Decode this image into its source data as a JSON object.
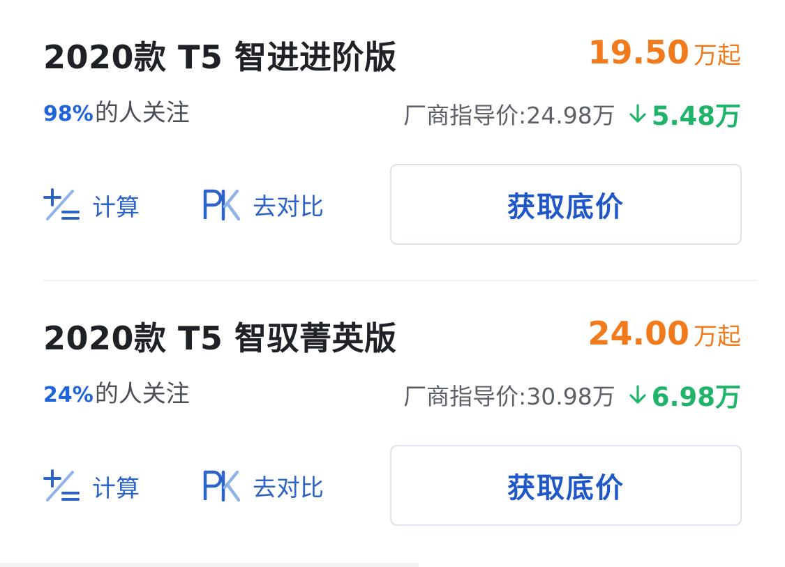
{
  "trims": [
    {
      "title": "2020款 T5 智进进阶版",
      "price": "19.50",
      "price_unit": "万起",
      "attention_percent": "98%",
      "attention_text": "的人关注",
      "guide_label": "厂商指导价:24.98万",
      "price_drop": "5.48万",
      "calc_label": "计算",
      "pk_label": "去对比",
      "cta_label": "获取底价"
    },
    {
      "title": "2020款 T5 智驭菁英版",
      "price": "24.00",
      "price_unit": "万起",
      "attention_percent": "24%",
      "attention_text": "的人关注",
      "guide_label": "厂商指导价:30.98万",
      "price_drop": "6.98万",
      "calc_label": "计算",
      "pk_label": "去对比",
      "cta_label": "获取底价"
    }
  ],
  "icons": {
    "calc": "calculator-icon",
    "pk": "pk-compare-icon",
    "down": "arrow-down-icon"
  },
  "colors": {
    "price": "#f07a1c",
    "attention": "#1f64d8",
    "drop": "#1fb46a",
    "accent": "#1f57c9",
    "title": "#1e2227"
  }
}
